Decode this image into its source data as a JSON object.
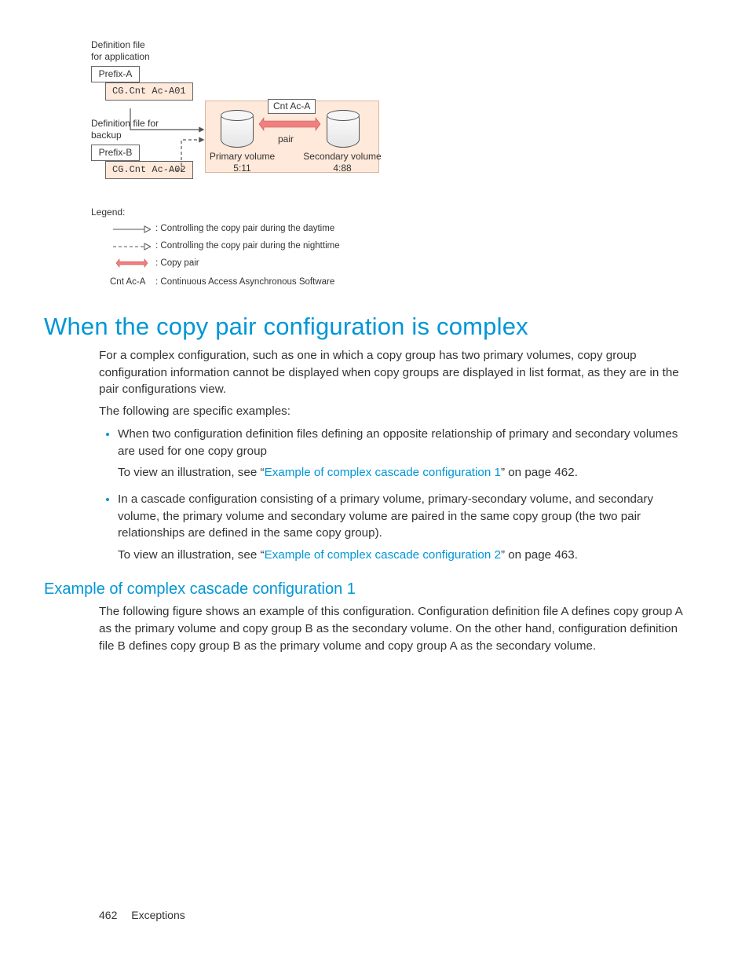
{
  "diagram": {
    "defFileApp": "Definition file\nfor application",
    "prefixA": "Prefix-A",
    "fileA": "CG.Cnt\nAc-A01",
    "defFileBackup": "Definition file for\nbackup",
    "prefixB": "Prefix-B",
    "fileB": "CG.Cnt\nAc-A02",
    "cntAc": "Cnt Ac-A",
    "pair": "pair",
    "primaryVolume": "Primary volume\n5:11",
    "secondaryVolume": "Secondary volume\n4:88",
    "legendTitle": "Legend:",
    "legend": {
      "r1": {
        "key": "——▷",
        "txt": ":  Controlling the copy pair during the daytime"
      },
      "r2": {
        "key": "-----▷",
        "txt": ":  Controlling the copy pair during the nighttime"
      },
      "r3": {
        "key": "↔",
        "txt": ":  Copy pair"
      },
      "r4": {
        "key": "Cnt Ac-A",
        "txt": ":  Continuous Access Asynchronous Software"
      }
    }
  },
  "h1": "When the copy pair configuration is complex",
  "para1": "For a complex configuration, such as one in which a copy group has two primary volumes, copy group configuration information cannot be displayed when copy groups are displayed in list format, as they are in the pair configurations view.",
  "para2": "The following are specific examples:",
  "bullets": [
    {
      "lead": "When two configuration definition files defining an opposite relationship of primary and secondary volumes are used for one copy group",
      "sub_pre": "To view an illustration, see “",
      "sub_link": "Example of complex cascade configuration 1",
      "sub_post": "” on page 462."
    },
    {
      "lead": "In a cascade configuration consisting of a primary volume, primary-secondary volume, and secondary volume, the primary volume and secondary volume are paired in the same copy group (the two pair relationships are defined in the same copy group).",
      "sub_pre": "To view an illustration, see “",
      "sub_link": "Example of complex cascade configuration 2",
      "sub_post": "” on page 463."
    }
  ],
  "h2": "Example of complex cascade configuration 1",
  "para3": "The following figure shows an example of this configuration. Configuration definition file A defines copy group A as the primary volume and copy group B as the secondary volume. On the other hand, configuration definition file B defines copy group B as the primary volume and copy group A as the secondary volume.",
  "footer": {
    "page": "462",
    "section": "Exceptions"
  }
}
